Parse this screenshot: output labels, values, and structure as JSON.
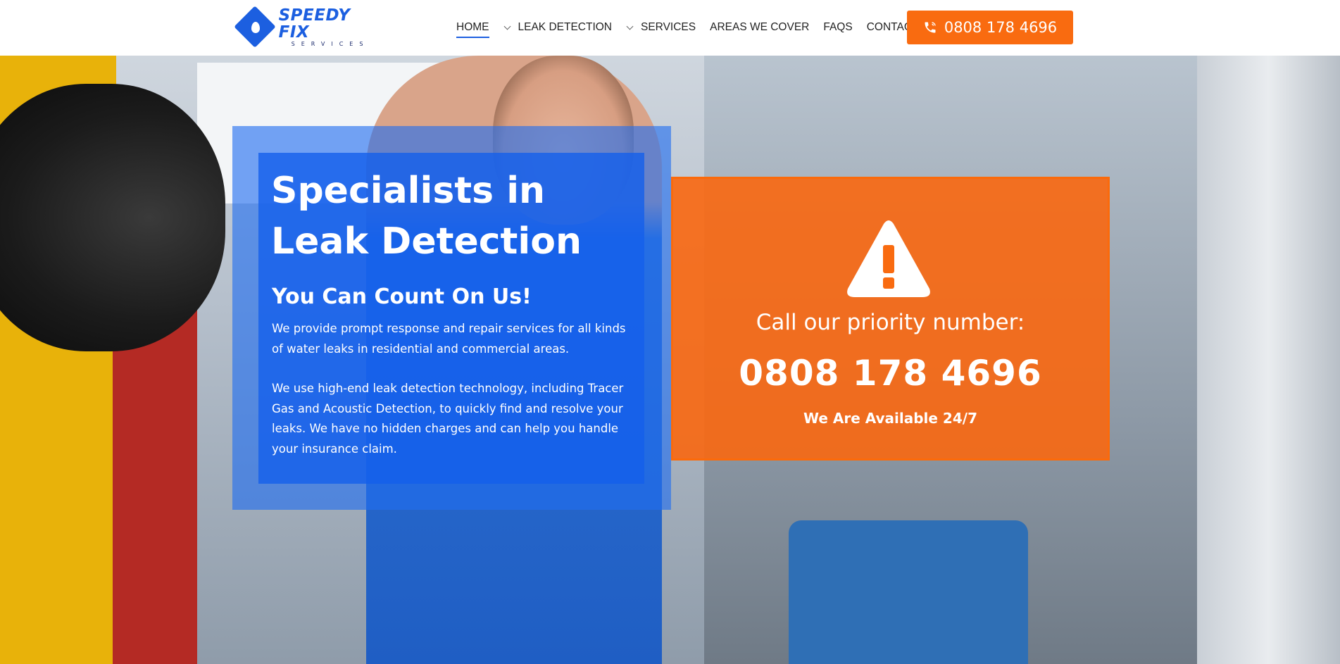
{
  "header": {
    "logo": {
      "name": "SPEEDY FIX",
      "tagline": "SERVICES"
    },
    "nav": [
      {
        "label": "HOME",
        "active": true,
        "dropdown": false
      },
      {
        "label": "LEAK DETECTION",
        "active": false,
        "dropdown": true
      },
      {
        "label": "SERVICES",
        "active": false,
        "dropdown": true
      },
      {
        "label": "AREAS WE COVER",
        "active": false,
        "dropdown": false
      },
      {
        "label": "FAQS",
        "active": false,
        "dropdown": false
      },
      {
        "label": "CONTACT",
        "active": false,
        "dropdown": false
      }
    ],
    "call_button": {
      "label": "0808 178 4696",
      "icon": "phone-icon"
    }
  },
  "hero": {
    "title_line1": "Specialists in",
    "title_line2": "Leak Detection",
    "subtitle": "You Can Count On Us!",
    "paragraph1": "We provide prompt response and repair services for all kinds of water leaks in residential and commercial areas.",
    "paragraph2": "We use high-end leak detection technology, including Tracer Gas and Acoustic Detection, to quickly find and resolve your leaks. We have no hidden charges and can help you handle your insurance claim."
  },
  "priority": {
    "icon": "warning-icon",
    "label": "Call our priority number:",
    "number": "0808 178 4696",
    "availability": "We Are Available 24/7"
  },
  "colors": {
    "brand_blue": "#1c5fe0",
    "brand_orange": "#f96b10"
  }
}
